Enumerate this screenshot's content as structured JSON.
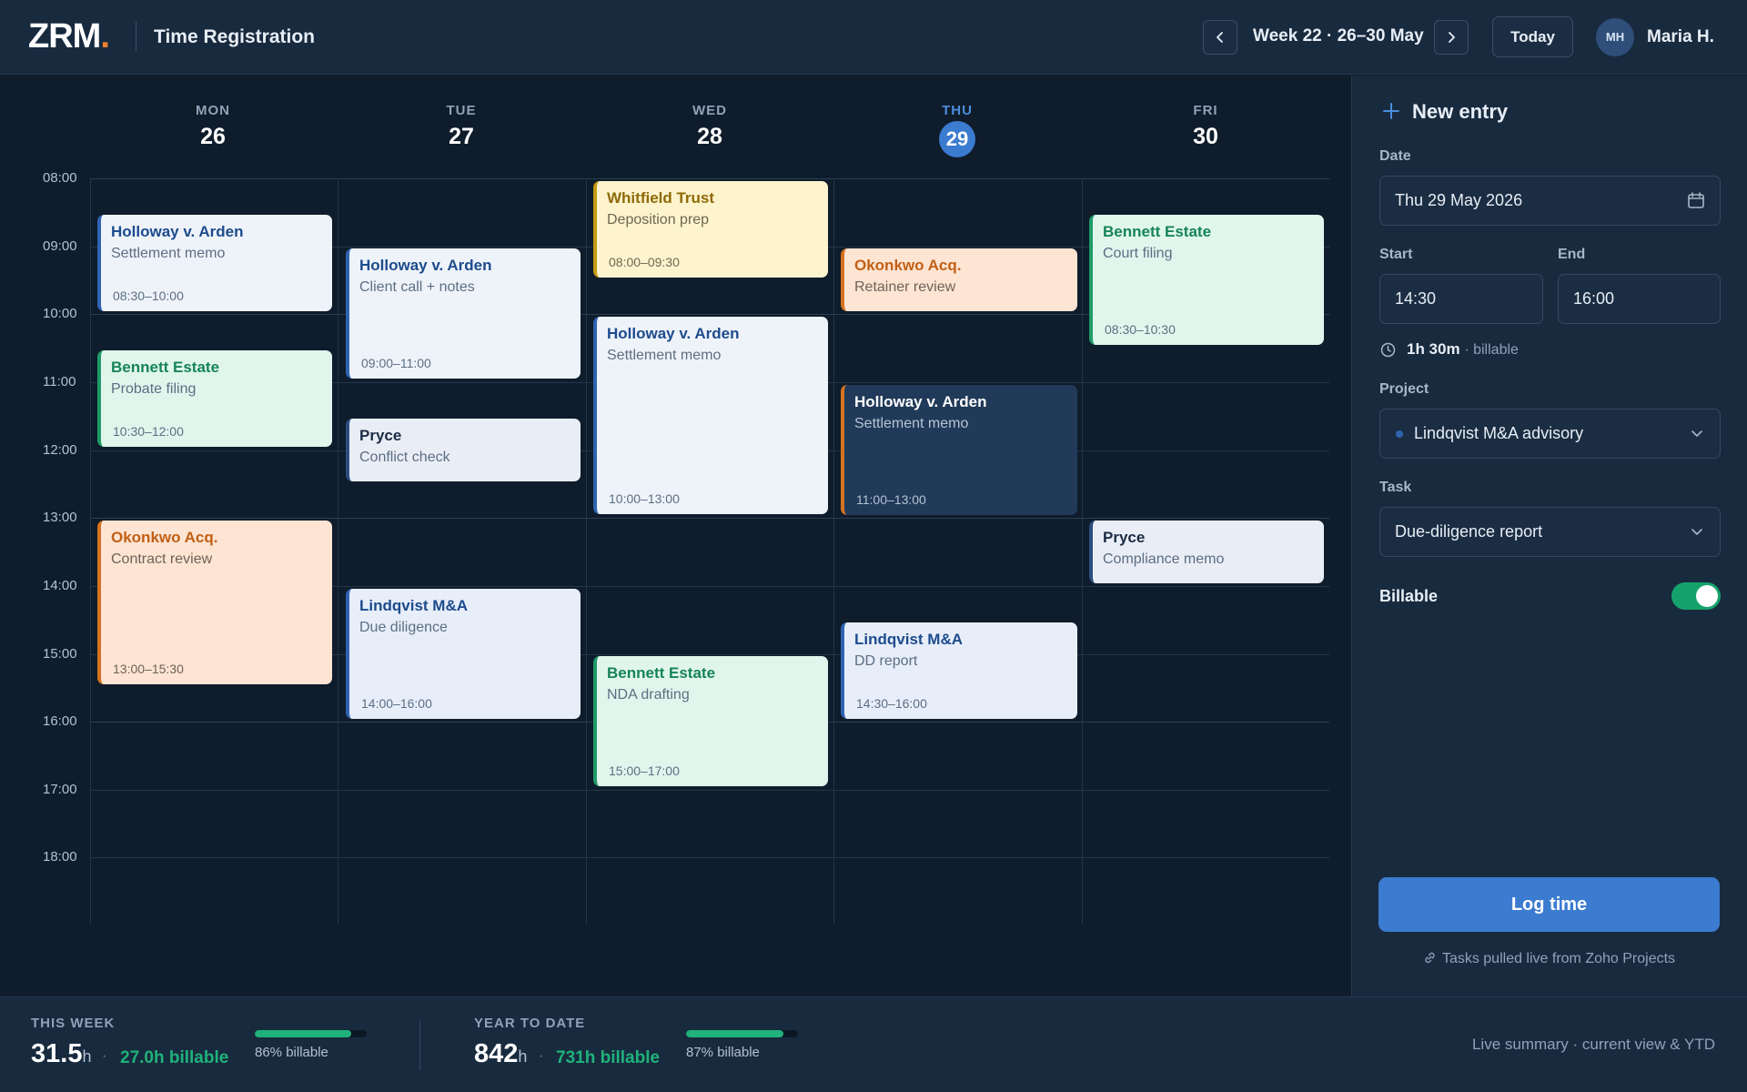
{
  "header": {
    "logo": "ZRM",
    "logo_dot": ".",
    "app_title": "Time Registration",
    "week_label": "Week 22 · 26–30 May",
    "today_label": "Today",
    "avatar_initials": "MH",
    "user_name": "Maria H."
  },
  "calendar": {
    "days": [
      {
        "name": "MON",
        "num": "26"
      },
      {
        "name": "TUE",
        "num": "27"
      },
      {
        "name": "WED",
        "num": "28"
      },
      {
        "name": "THU",
        "num": "29"
      },
      {
        "name": "FRI",
        "num": "30"
      }
    ],
    "today_index": 3,
    "hours": [
      "08:00",
      "09:00",
      "10:00",
      "11:00",
      "12:00",
      "13:00",
      "14:00",
      "15:00",
      "16:00",
      "17:00",
      "18:00"
    ],
    "events": [
      {
        "title": "Holloway v. Arden",
        "sub": "Settlement memo",
        "time": "08:30–10:00"
      },
      {
        "title": "Bennett Estate",
        "sub": "Probate filing",
        "time": "10:30–12:00"
      },
      {
        "title": "Okonkwo Acq.",
        "sub": "Contract review",
        "time": "13:00–15:30"
      },
      {
        "title": "Holloway v. Arden",
        "sub": "Client call + notes",
        "time": "09:00–11:00"
      },
      {
        "title": "Pryce",
        "sub": "Conflict check",
        "time": ""
      },
      {
        "title": "Lindqvist M&A",
        "sub": "Due diligence",
        "time": "14:00–16:00"
      },
      {
        "title": "Whitfield Trust",
        "sub": "Deposition prep",
        "time": "08:00–09:30"
      },
      {
        "title": "Holloway v. Arden",
        "sub": "Settlement memo",
        "time": "10:00–13:00"
      },
      {
        "title": "Bennett Estate",
        "sub": "NDA drafting",
        "time": "15:00–17:00"
      },
      {
        "title": "Okonkwo Acq.",
        "sub": "Retainer review",
        "time": ""
      },
      {
        "title": "Holloway v. Arden",
        "sub": "Settlement memo",
        "time": "11:00–13:00"
      },
      {
        "title": "Lindqvist M&A",
        "sub": "DD report",
        "time": "14:30–16:00"
      },
      {
        "title": "Bennett Estate",
        "sub": "Court filing",
        "time": "08:30–10:30"
      },
      {
        "title": "Pryce",
        "sub": "Compliance memo",
        "time": ""
      }
    ]
  },
  "panel": {
    "title": "New entry",
    "date_label": "Date",
    "date_value": "Thu 29 May 2026",
    "start_label": "Start",
    "start_value": "14:30",
    "end_label": "End",
    "end_value": "16:00",
    "duration": "1h 30m",
    "duration_note": "· billable",
    "project_label": "Project",
    "project_value": "Lindqvist M&A advisory",
    "task_label": "Task",
    "task_value": "Due-diligence report",
    "billable_label": "Billable",
    "billable_on": true,
    "log_button": "Log time",
    "source_note": "Tasks pulled live from Zoho Projects"
  },
  "footer": {
    "week_label": "THIS WEEK",
    "week_hours": "31.5",
    "week_unit": "h",
    "week_sep": "·",
    "week_billable": "27.0h billable",
    "week_pct_label": "86% billable",
    "week_pct": 0.86,
    "ytd_label": "YEAR TO DATE",
    "ytd_hours": "842",
    "ytd_unit": "h",
    "ytd_sep": "·",
    "ytd_billable": "731h billable",
    "ytd_pct_label": "87% billable",
    "ytd_pct": 0.87,
    "live_note": "Live summary · current view & YTD"
  },
  "colors": {
    "accent": "#3b7bd0",
    "billable_green": "#1fb27a",
    "brand_dot": "#e8822a"
  }
}
